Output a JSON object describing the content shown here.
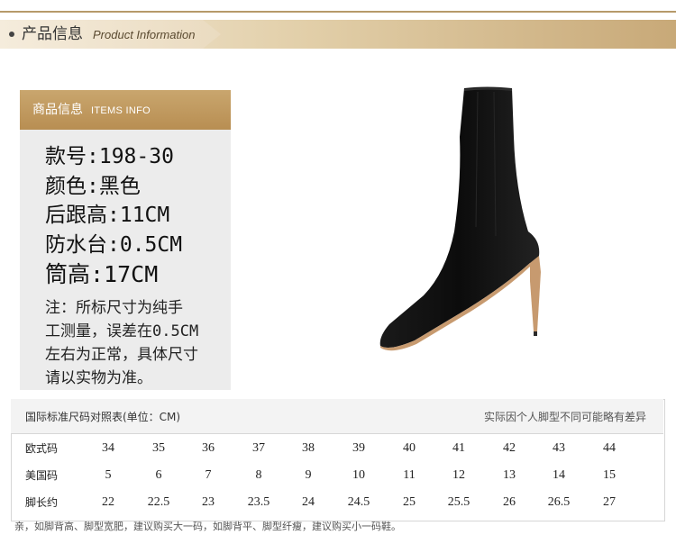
{
  "banner": {
    "title_zh": "产品信息",
    "title_en": "Product Information"
  },
  "info_card": {
    "header_zh": "商品信息",
    "header_en": "ITEMS INFO",
    "specs": [
      "款号:198-30",
      "颜色:黑色",
      "后跟高:11CM",
      "防水台:0.5CM",
      "筒高:17CM"
    ],
    "note_lines": [
      "注：所标尺寸为纯手",
      "工测量，误差在0.5CM",
      "左右为正常，具体尺寸",
      "请以实物为准。"
    ]
  },
  "size_table": {
    "title": "国际标准尺码对照表(单位：CM)",
    "note": "实际因个人脚型不同可能略有差异",
    "rows": [
      {
        "label": "欧式码",
        "values": [
          "34",
          "35",
          "36",
          "37",
          "38",
          "39",
          "40",
          "41",
          "42",
          "43",
          "44"
        ]
      },
      {
        "label": "美国码",
        "values": [
          "5",
          "6",
          "7",
          "8",
          "9",
          "10",
          "11",
          "12",
          "13",
          "14",
          "15"
        ]
      },
      {
        "label": "脚长约",
        "values": [
          "22",
          "22.5",
          "23",
          "23.5",
          "24",
          "24.5",
          "25",
          "25.5",
          "26",
          "26.5",
          "27"
        ]
      }
    ]
  },
  "footnote": "亲，如脚背高、脚型宽肥，建议购买大一码，如脚背平、脚型纤瘦，建议购买小一码鞋。",
  "colors": {
    "accent": "#b88e52",
    "card_bg": "#ececec",
    "boot": "#111111"
  }
}
